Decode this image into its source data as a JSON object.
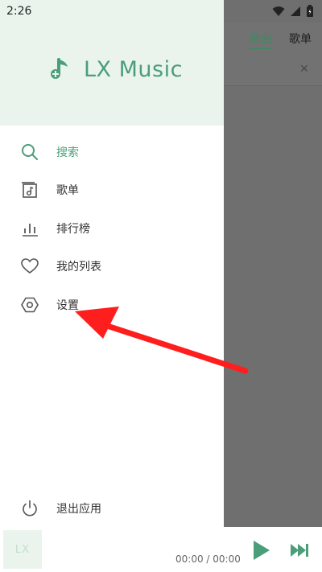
{
  "status_bar": {
    "time": "2:26"
  },
  "background_app": {
    "tabs": [
      {
        "label": "歌曲"
      },
      {
        "label": "歌单"
      }
    ]
  },
  "drawer": {
    "brand": "LX Music",
    "menu": [
      {
        "label": "搜索"
      },
      {
        "label": "歌单"
      },
      {
        "label": "排行榜"
      },
      {
        "label": "我的列表"
      },
      {
        "label": "设置"
      }
    ],
    "exit_label": "退出应用"
  },
  "player": {
    "thumb": "LX",
    "time": "00:00 / 00:00"
  },
  "colors": {
    "accent": "#4a9e7a",
    "header_bg": "#eaf4ec",
    "arrow": "#ff1e1e"
  }
}
